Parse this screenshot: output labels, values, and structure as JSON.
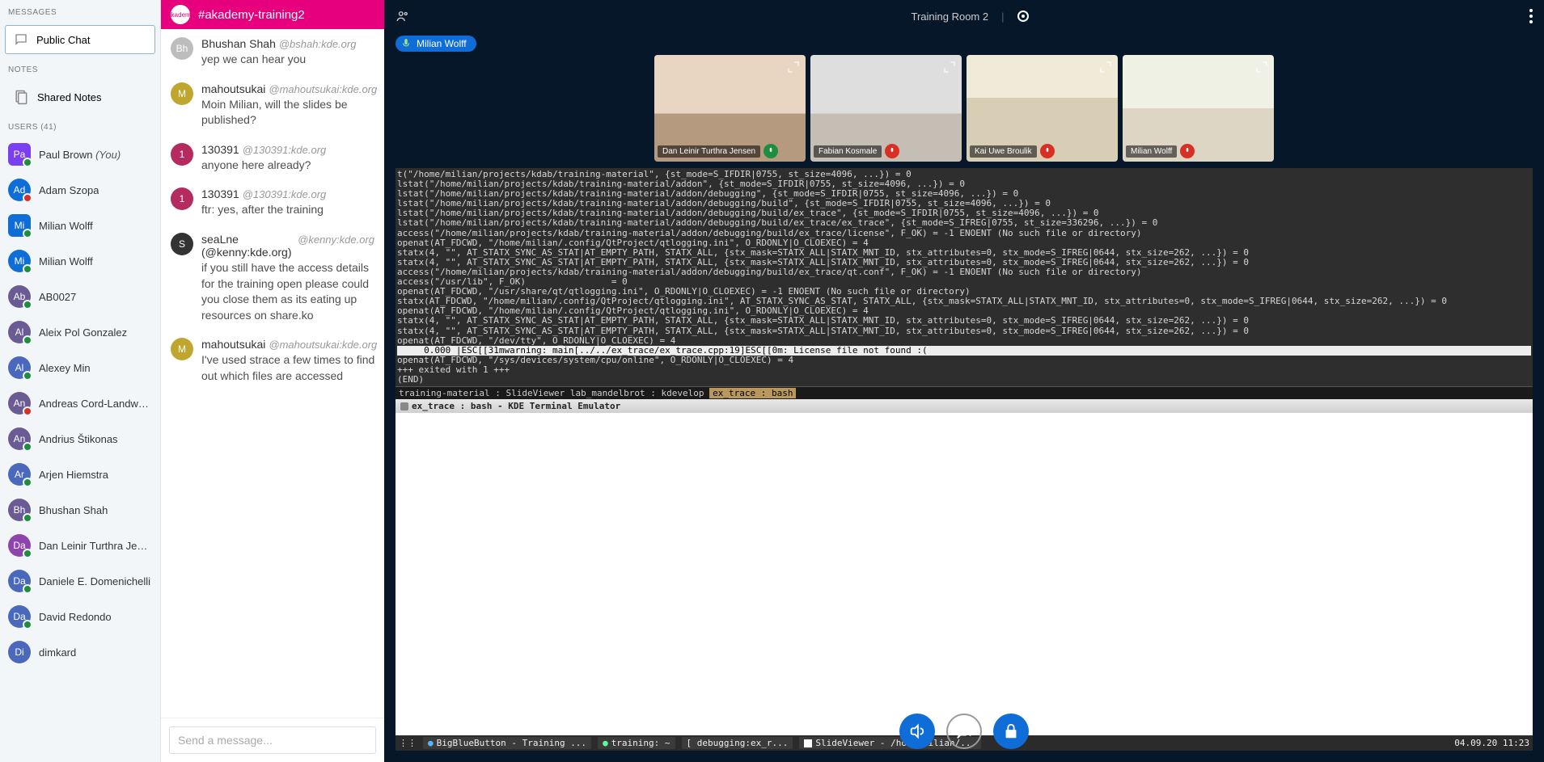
{
  "sidebar": {
    "messages_header": "MESSAGES",
    "public_chat": "Public Chat",
    "notes_header": "NOTES",
    "shared_notes": "Shared Notes",
    "users_header": "USERS (41)",
    "users": [
      {
        "initials": "Pa",
        "name": "Paul Brown",
        "you": "(You)",
        "color": "#7b3ff2",
        "shape": "square",
        "badge": "#1e8e3e"
      },
      {
        "initials": "Ad",
        "name": "Adam Szopa",
        "color": "#0f6dd8",
        "badge": "#d93025"
      },
      {
        "initials": "Mi",
        "name": "Milian Wolff",
        "color": "#0f6dd8",
        "shape": "square",
        "badge": "#1e8e3e"
      },
      {
        "initials": "Mi",
        "name": "Milian Wolff",
        "color": "#0f6dd8",
        "badge": "#1e8e3e"
      },
      {
        "initials": "Ab",
        "name": "AB0027",
        "color": "#6b5b95",
        "badge": "#1e8e3e"
      },
      {
        "initials": "Al",
        "name": "Aleix Pol Gonzalez",
        "color": "#6b5b95",
        "badge": "#1e8e3e"
      },
      {
        "initials": "Al",
        "name": "Alexey Min",
        "color": "#4a69bd",
        "badge": "#1e8e3e"
      },
      {
        "initials": "An",
        "name": "Andreas Cord-Landwehr",
        "color": "#6b5b95",
        "badge": "#d93025"
      },
      {
        "initials": "An",
        "name": "Andrius Štikonas",
        "color": "#6b5b95",
        "badge": "#1e8e3e"
      },
      {
        "initials": "Ar",
        "name": "Arjen Hiemstra",
        "color": "#4a69bd",
        "badge": "#1e8e3e"
      },
      {
        "initials": "Bh",
        "name": "Bhushan Shah",
        "color": "#6b5b95",
        "badge": "#1e8e3e"
      },
      {
        "initials": "Da",
        "name": "Dan Leinir Turthra Jensen",
        "color": "#8e44ad",
        "badge": "#1e8e3e"
      },
      {
        "initials": "Da",
        "name": "Daniele E. Domenichelli",
        "color": "#4a69bd",
        "badge": "#1e8e3e"
      },
      {
        "initials": "Da",
        "name": "David Redondo",
        "color": "#4a69bd",
        "badge": "#1e8e3e"
      },
      {
        "initials": "Di",
        "name": "dimkard",
        "color": "#4a69bd"
      }
    ]
  },
  "chat": {
    "channel": "#akademy-training2",
    "input_placeholder": "Send a message...",
    "messages": [
      {
        "av": "Bh",
        "avbg": "#bdbdbd",
        "name": "Bhushan Shah",
        "handle": "@bshah:kde.org",
        "text": "yep we can hear you"
      },
      {
        "av": "M",
        "avbg": "#c0a62e",
        "name": "mahoutsukai",
        "handle": "@mahoutsukai:kde.org",
        "text": "Moin Milian, will the slides be published?"
      },
      {
        "av": "1",
        "avbg": "#b52b5f",
        "name": "130391",
        "handle": "@130391:kde.org",
        "text": "anyone here already?"
      },
      {
        "av": "1",
        "avbg": "#b52b5f",
        "name": "130391",
        "handle": "@130391:kde.org",
        "text": "ftr: yes, after the training"
      },
      {
        "av": "S",
        "avbg": "#333",
        "name": "seaLne (@kenny:kde.org)",
        "handle": "@kenny:kde.org",
        "text": "if you still have the access details for the training open please could you close them as its eating up resources on share.ko"
      },
      {
        "av": "M",
        "avbg": "#c0a62e",
        "name": "mahoutsukai",
        "handle": "@mahoutsukai:kde.org",
        "text": "I've used strace a few times to find out which files are accessed"
      }
    ]
  },
  "main": {
    "room_title": "Training Room 2",
    "presenter": "Milian Wolff",
    "videos": [
      {
        "name": "Dan Leinir Turthra Jensen",
        "muted": false,
        "room": "room"
      },
      {
        "name": "Fabian Kosmale",
        "muted": true,
        "room": "room2"
      },
      {
        "name": "Kai Uwe Broulik",
        "muted": true,
        "room": "room3"
      },
      {
        "name": "Milian Wolff",
        "muted": true,
        "room": "room4"
      }
    ],
    "terminal_lines": [
      "t(\"/home/milian/projects/kdab/training-material\", {st_mode=S_IFDIR|0755, st_size=4096, ...}) = 0",
      "lstat(\"/home/milian/projects/kdab/training-material/addon\", {st_mode=S_IFDIR|0755, st_size=4096, ...}) = 0",
      "lstat(\"/home/milian/projects/kdab/training-material/addon/debugging\", {st_mode=S_IFDIR|0755, st_size=4096, ...}) = 0",
      "lstat(\"/home/milian/projects/kdab/training-material/addon/debugging/build\", {st_mode=S_IFDIR|0755, st_size=4096, ...}) = 0",
      "lstat(\"/home/milian/projects/kdab/training-material/addon/debugging/build/ex_trace\", {st_mode=S_IFDIR|0755, st_size=4096, ...}) = 0",
      "lstat(\"/home/milian/projects/kdab/training-material/addon/debugging/build/ex_trace/ex_trace\", {st_mode=S_IFREG|0755, st_size=336296, ...}) = 0",
      "access(\"/home/milian/projects/kdab/training-material/addon/debugging/build/ex_trace/license\", F_OK) = -1 ENOENT (No such file or directory)",
      "openat(AT_FDCWD, \"/home/milian/.config/QtProject/qtlogging.ini\", O_RDONLY|O_CLOEXEC) = 4",
      "statx(4, \"\", AT_STATX_SYNC_AS_STAT|AT_EMPTY_PATH, STATX_ALL, {stx_mask=STATX_ALL|STATX_MNT_ID, stx_attributes=0, stx_mode=S_IFREG|0644, stx_size=262, ...}) = 0",
      "statx(4, \"\", AT_STATX_SYNC_AS_STAT|AT_EMPTY_PATH, STATX_ALL, {stx_mask=STATX_ALL|STATX_MNT_ID, stx_attributes=0, stx_mode=S_IFREG|0644, stx_size=262, ...}) = 0",
      "access(\"/home/milian/projects/kdab/training-material/addon/debugging/build/ex_trace/qt.conf\", F_OK) = -1 ENOENT (No such file or directory)",
      "access(\"/usr/lib\", F_OK)                = 0",
      "openat(AT_FDCWD, \"/usr/share/qt/qtlogging.ini\", O_RDONLY|O_CLOEXEC) = -1 ENOENT (No such file or directory)",
      "statx(AT_FDCWD, \"/home/milian/.config/QtProject/qtlogging.ini\", AT_STATX_SYNC_AS_STAT, STATX_ALL, {stx_mask=STATX_ALL|STATX_MNT_ID, stx_attributes=0, stx_mode=S_IFREG|0644, stx_size=262, ...}) = 0",
      "openat(AT_FDCWD, \"/home/milian/.config/QtProject/qtlogging.ini\", O_RDONLY|O_CLOEXEC) = 4",
      "statx(4, \"\", AT_STATX_SYNC_AS_STAT|AT_EMPTY_PATH, STATX_ALL, {stx_mask=STATX_ALL|STATX_MNT_ID, stx_attributes=0, stx_mode=S_IFREG|0644, stx_size=262, ...}) = 0",
      "statx(4, \"\", AT_STATX_SYNC_AS_STAT|AT_EMPTY_PATH, STATX_ALL, {stx_mask=STATX_ALL|STATX_MNT_ID, stx_attributes=0, stx_mode=S_IFREG|0644, stx_size=262, ...}) = 0",
      "openat(AT_FDCWD, \"/dev/tty\", O_RDONLY|O_CLOEXEC) = 4"
    ],
    "terminal_highlight": "     0.000 |ESC[[31mwarning: main[../../ex_trace/ex_trace.cpp:19]ESC[[0m: License file not found :(",
    "terminal_tail": [
      "openat(AT_FDCWD, \"/sys/devices/system/cpu/online\", O_RDONLY|O_CLOEXEC) = 4",
      "+++ exited with 1 +++",
      "(END)"
    ],
    "term_tabs_left": " training-material : SlideViewer  lab_mandelbrot : kdevelop ",
    "term_tabs_active": "ex_trace : bash",
    "window_title": "ex_trace : bash - KDE Terminal Emulator",
    "taskbar": {
      "tasks": [
        "BigBlueButton - Training ...",
        "training:   ~",
        "[ debugging:ex_r...",
        "SlideViewer - /home/milian/..."
      ],
      "clock": "04.09.20 11:23"
    }
  }
}
